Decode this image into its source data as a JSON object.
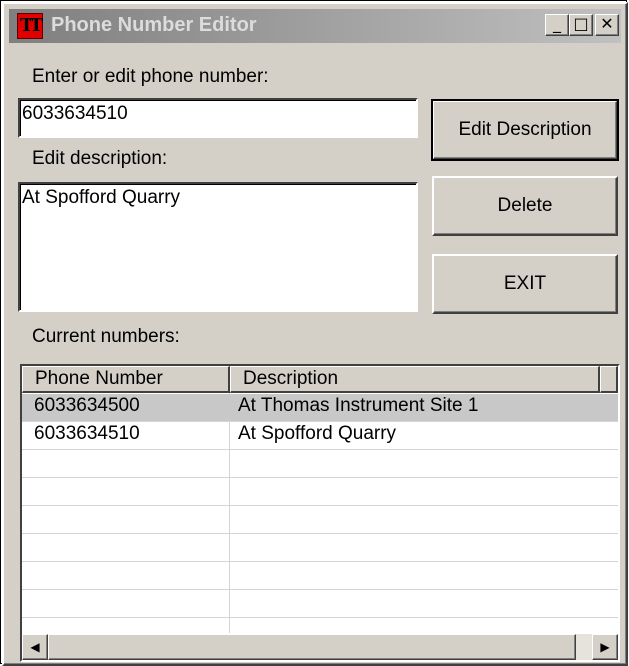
{
  "window": {
    "title": "Phone Number Editor",
    "app_icon": "TT",
    "controls": {
      "minimize": "_",
      "maximize": "□",
      "close": "✕"
    }
  },
  "form": {
    "phone_label": "Enter or edit phone number:",
    "phone_value": "6033634510",
    "description_label": "Edit description:",
    "description_value": "At Spofford Quarry",
    "current_label": "Current numbers:"
  },
  "buttons": {
    "edit_description": "Edit Description",
    "delete": "Delete",
    "exit": "EXIT"
  },
  "table": {
    "columns": [
      "Phone Number",
      "Description"
    ],
    "rows": [
      {
        "phone": "6033634500",
        "description": "At Thomas Instrument Site 1",
        "selected": true
      },
      {
        "phone": "6033634510",
        "description": "At Spofford Quarry",
        "selected": false
      }
    ],
    "scroll_left_icon": "◀",
    "scroll_right_icon": "▶"
  }
}
